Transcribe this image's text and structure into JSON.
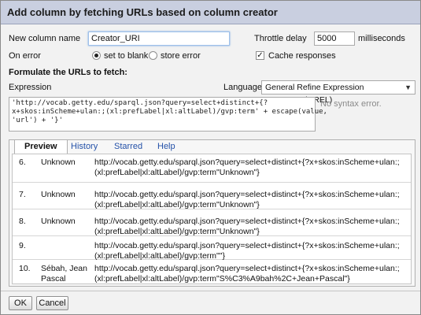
{
  "dialog": {
    "title": "Add column by fetching URLs based on column creator"
  },
  "form": {
    "new_column_label": "New column name",
    "new_column_value": "Creator_URI",
    "throttle_label": "Throttle delay",
    "throttle_value": "5000",
    "throttle_unit": "milliseconds",
    "on_error_label": "On error",
    "on_error_options": [
      "set to blank",
      "store error"
    ],
    "cache_label": "Cache responses",
    "formulate_heading": "Formulate the URLs to fetch:",
    "expression_label": "Expression",
    "language_label": "Language",
    "language_value": "General Refine Expression Language (GREL)",
    "expression_line1": "'http://vocab.getty.edu/sparql.json?query=select+distinct+{?",
    "expression_line2": "x+skos:inScheme+ulan:;(xl:prefLabel|xl:altLabel)/gvp:term' + escape(value,",
    "expression_line3": "'url') + '}'",
    "syntax_status": "No syntax error."
  },
  "tabs": [
    "Preview",
    "History",
    "Starred",
    "Help"
  ],
  "preview_rows": [
    {
      "index": "6.",
      "value": "Unknown",
      "url_line1": "http://vocab.getty.edu/sparql.json?query=select+distinct+{?x+skos:inScheme+ulan:;",
      "url_line2": "(xl:prefLabel|xl:altLabel)/gvp:term\"Unknown\"}"
    },
    {
      "index": "7.",
      "value": "Unknown",
      "url_line1": "http://vocab.getty.edu/sparql.json?query=select+distinct+{?x+skos:inScheme+ulan:;",
      "url_line2": "(xl:prefLabel|xl:altLabel)/gvp:term\"Unknown\"}"
    },
    {
      "index": "8.",
      "value": "Unknown",
      "url_line1": "http://vocab.getty.edu/sparql.json?query=select+distinct+{?x+skos:inScheme+ulan:;",
      "url_line2": "(xl:prefLabel|xl:altLabel)/gvp:term\"Unknown\"}"
    },
    {
      "index": "9.",
      "value": "",
      "url_line1": "http://vocab.getty.edu/sparql.json?query=select+distinct+{?x+skos:inScheme+ulan:;",
      "url_line2": "(xl:prefLabel|xl:altLabel)/gvp:term\"\"}"
    },
    {
      "index": "10.",
      "value": "Sébah, Jean\nPascal",
      "url_line1": "http://vocab.getty.edu/sparql.json?query=select+distinct+{?x+skos:inScheme+ulan:;",
      "url_line2": "(xl:prefLabel|xl:altLabel)/gvp:term\"S%C3%A9bah%2C+Jean+Pascal\"}"
    }
  ],
  "buttons": {
    "ok": "OK",
    "cancel": "Cancel"
  }
}
